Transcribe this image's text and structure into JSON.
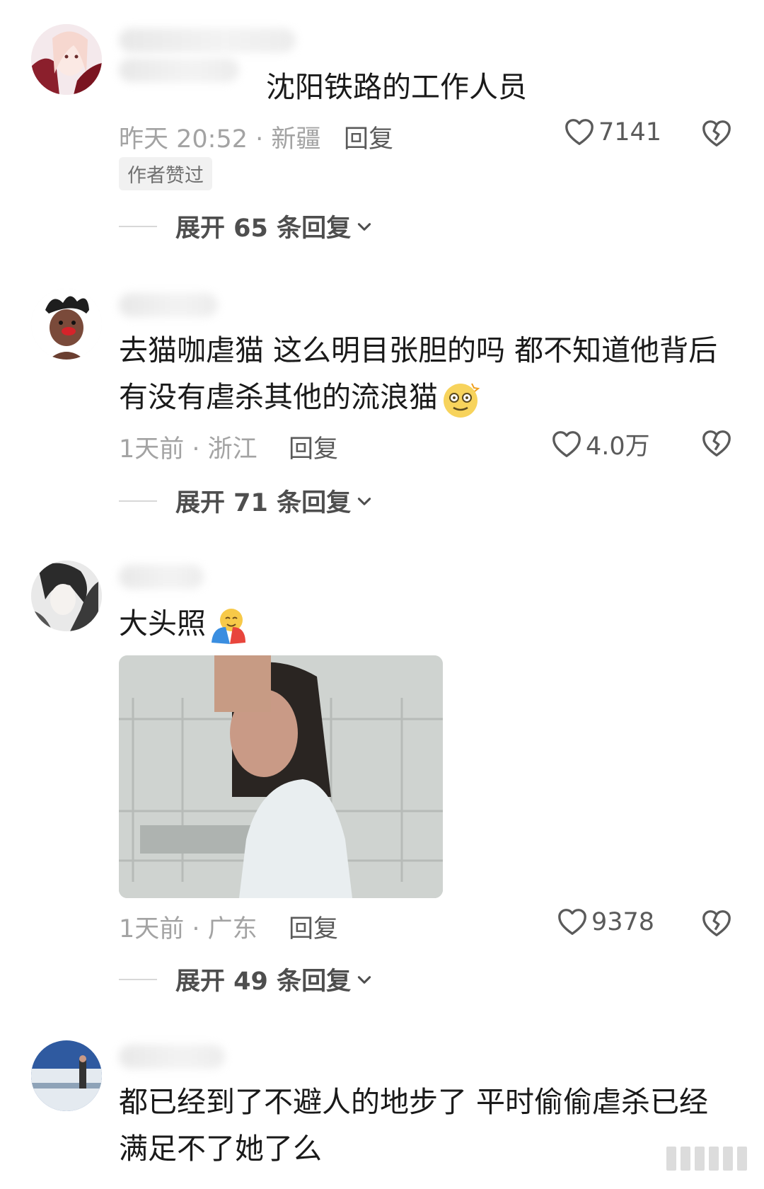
{
  "comments": [
    {
      "text_lines": [
        "沈阳铁路的工作人员"
      ],
      "time_location": "昨天 20:52 · 新疆",
      "reply_label": "回复",
      "likes": "7141",
      "badge": "作者赞过",
      "expand_label": "展开 65 条回复"
    },
    {
      "text_lines": [
        "去猫咖虐猫 这么明目张胆的吗 都不知道他背后",
        "有没有虐杀其他的流浪猫"
      ],
      "time_location": "1天前 · 浙江",
      "reply_label": "回复",
      "likes": "4.0万",
      "expand_label": "展开 71 条回复"
    },
    {
      "text_lines": [
        "大头照"
      ],
      "time_location": "1天前 · 广东",
      "reply_label": "回复",
      "likes": "9378",
      "expand_label": "展开 49 条回复"
    },
    {
      "text_lines": [
        "都已经到了不避人的地步了 平时偷偷虐杀已经",
        "满足不了她了么"
      ]
    }
  ],
  "icons": {
    "like": "heart-outline-icon",
    "dislike": "broken-heart-icon",
    "expand": "chevron-down-icon"
  }
}
